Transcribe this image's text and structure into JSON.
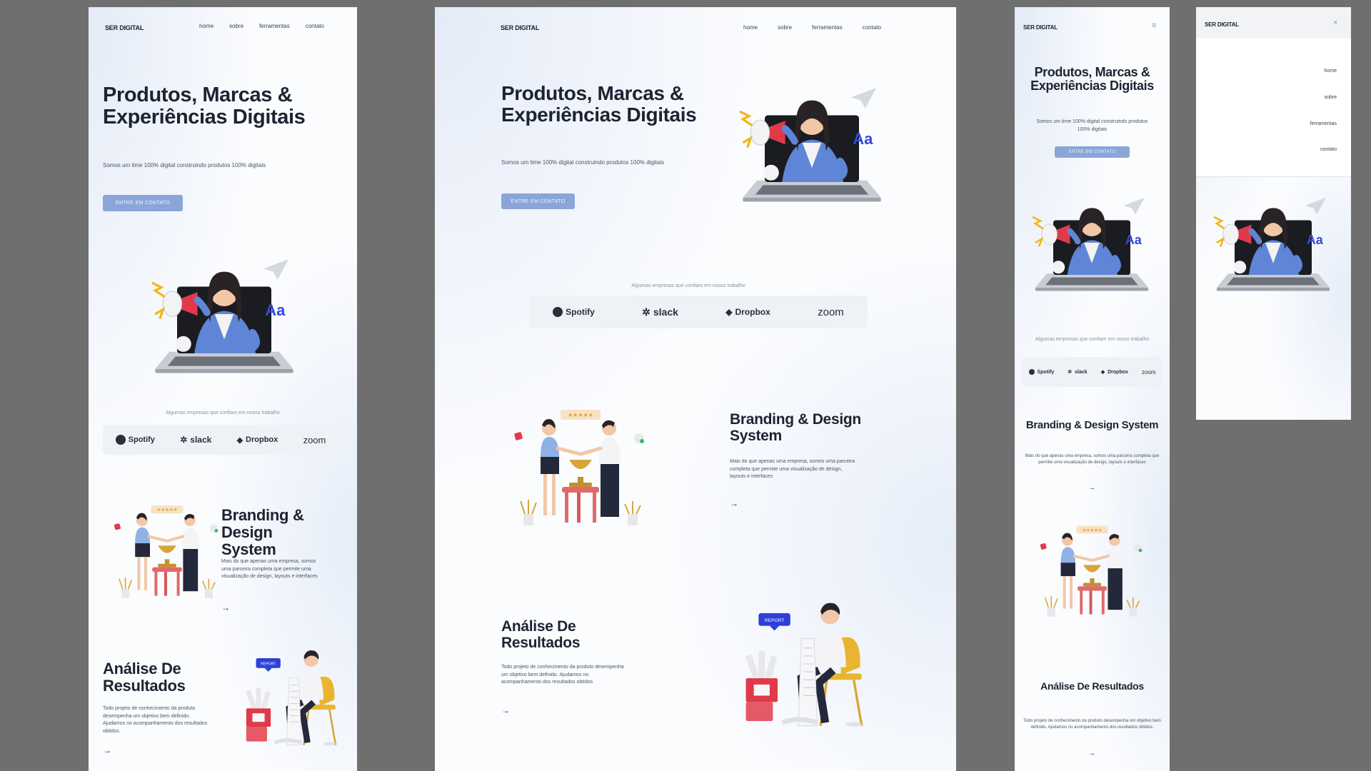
{
  "site": {
    "logo": "SER DIGITAL",
    "nav": [
      "home",
      "sobre",
      "ferramentas",
      "contato"
    ],
    "menu_icon": "≡",
    "close_icon": "×",
    "hero_title": "Produtos, Marcas & Experiências Digitais",
    "hero_text": "Somos um time 100% digital construindo produtos 100% digitais",
    "cta": "ENTRE EM CONTATO",
    "partners_text": "Algumas empresas que confiam em nosso trabalho",
    "brands": [
      "Spotify",
      "slack",
      "Dropbox",
      "zoom"
    ],
    "branding_title": "Branding & Design System",
    "branding_text": "Mais do que apenas uma empresa, somos uma parceira completa que permite uma visualização de design, layouts e interfaces",
    "analysis_title": "Análise De Resultados",
    "analysis_text": "Todo projeto de conhecimento da produto desempenha um objetivo bem definido. Ajudamos no acompanhamento dos resultados obtidos.",
    "report_badge": "REPORT",
    "arrow": "→"
  },
  "colors": {
    "background": "#6f6f6f",
    "frame": "#fbfcfe",
    "cta": "#8aa6d8",
    "accent_blue": "#2c3fd9",
    "red": "#e03a4a"
  }
}
